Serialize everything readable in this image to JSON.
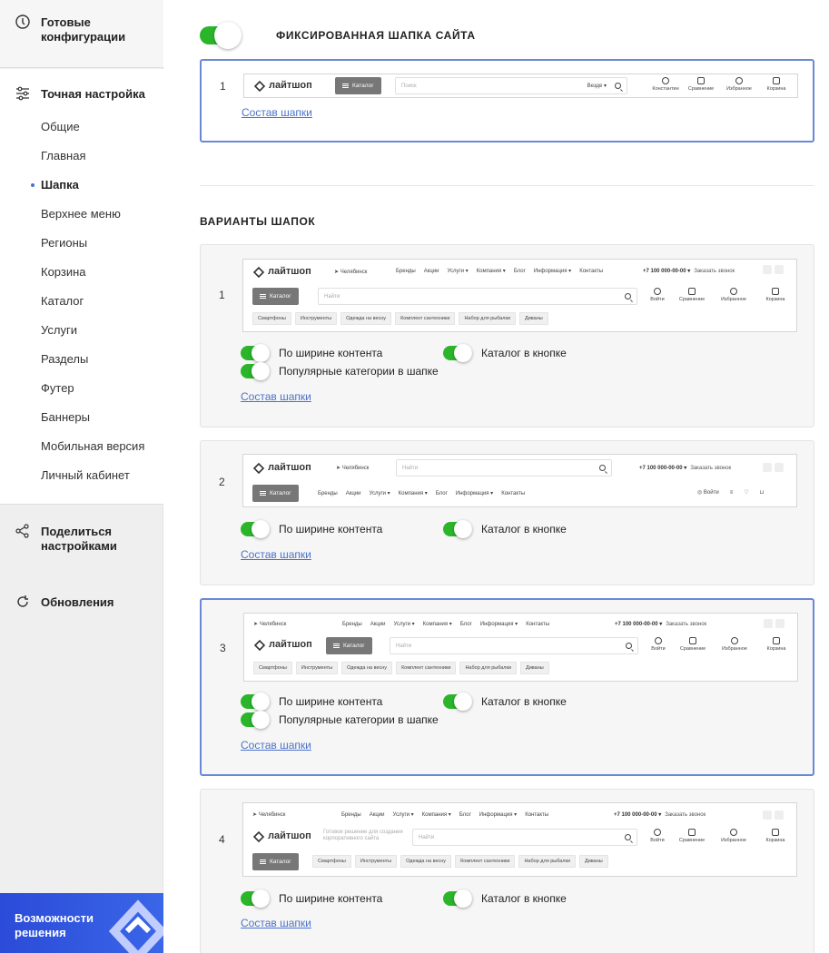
{
  "sidebar": {
    "ready_configs": "Готовые конфигурации",
    "fine_tuning": "Точная настройка",
    "items": [
      {
        "label": "Общие"
      },
      {
        "label": "Главная"
      },
      {
        "label": "Шапка",
        "active": true
      },
      {
        "label": "Верхнее меню"
      },
      {
        "label": "Регионы"
      },
      {
        "label": "Корзина"
      },
      {
        "label": "Каталог"
      },
      {
        "label": "Услуги"
      },
      {
        "label": "Разделы"
      },
      {
        "label": "Футер"
      },
      {
        "label": "Баннеры"
      },
      {
        "label": "Мобильная версия"
      },
      {
        "label": "Личный кабинет"
      }
    ],
    "share": "Поделиться настройками",
    "updates": "Обновления",
    "promo": "Возможности решения"
  },
  "fixed_header": {
    "title": "ФИКСИРОВАННАЯ ШАПКА САЙТА",
    "toggle_on": true,
    "number": "1",
    "link": "Состав шапки"
  },
  "variants_title": "ВАРИАНТЫ ШАПОК",
  "preview": {
    "logo": "лайтшоп",
    "catalog": "Каталог",
    "search_placeholder": "Поиск",
    "search_placeholder2": "Найти",
    "where": "Везде ▾",
    "city": "Челябинск",
    "phone": "+7 100 000-00-00 ▾",
    "callback": "Заказать звонок",
    "tagline": "Готовое решение для создания корпоративного сайта",
    "menu": [
      "Бренды",
      "Акции",
      "Услуги ▾",
      "Компания ▾",
      "Блог",
      "Информация ▾",
      "Контакты"
    ],
    "icons_top": [
      "Константин",
      "Сравнение",
      "Избранное",
      "Корзина"
    ],
    "icons": [
      "Войти",
      "Сравнение",
      "Избранное",
      "Корзина"
    ],
    "login": "Войти",
    "chips": [
      "Смартфоны",
      "Инструменты",
      "Одежда на весну",
      "Комплект сантехники",
      "Набор для рыбалки",
      "Диваны"
    ]
  },
  "variants": [
    {
      "number": "1",
      "opt_width": "По ширине контента",
      "opt_catalog": "Каталог в кнопке",
      "opt_popular": "Популярные категории в шапке",
      "link": "Состав шапки"
    },
    {
      "number": "2",
      "opt_width": "По ширине контента",
      "opt_catalog": "Каталог в кнопке",
      "link": "Состав шапки"
    },
    {
      "number": "3",
      "opt_width": "По ширине контента",
      "opt_catalog": "Каталог в кнопке",
      "opt_popular": "Популярные категории в шапке",
      "link": "Состав шапки",
      "selected": true
    },
    {
      "number": "4",
      "opt_width": "По ширине контента",
      "opt_catalog": "Каталог в кнопке",
      "link": "Состав шапки"
    }
  ]
}
